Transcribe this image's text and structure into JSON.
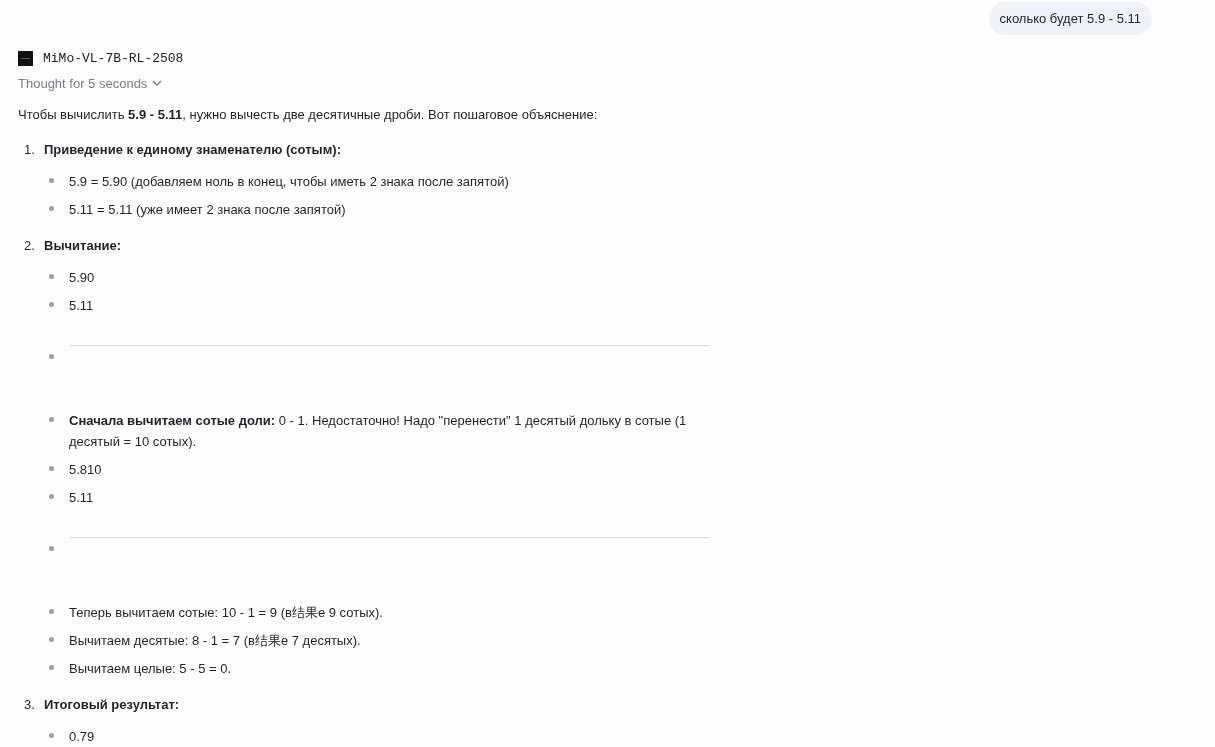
{
  "user_message": "сколько будет 5.9 - 5.11",
  "model": {
    "name": "MiMo-VL-7B-RL-2508"
  },
  "thought": {
    "label": "Thought for 5 seconds",
    "expanded": false
  },
  "intro": "Чтобы вычислить **5.9 - 5.11**, нужно вычесть две десятичные дроби. Вот пошаговое объяснение:",
  "steps": [
    {
      "number": "1.",
      "title": "Приведение к единому знаменателю (сотым):",
      "items": [
        {
          "kind": "text",
          "text": "5.9 = 5.90 (добавляем ноль в конец, чтобы иметь 2 знака после запятой)"
        },
        {
          "kind": "text",
          "text": "5.11 = 5.11 (уже имеет 2 знака после запятой)"
        }
      ]
    },
    {
      "number": "2.",
      "title": "Вычитание:",
      "items": [
        {
          "kind": "text",
          "text": "5.90"
        },
        {
          "kind": "text",
          "text": "5.11"
        },
        {
          "kind": "rule"
        },
        {
          "kind": "text",
          "text": "**Сначала вычитаем сотые доли:** 0 - 1. Недостаточно! Надо \"перенести\" 1 десятый дольку в сотые (1 десятый = 10 сотых)."
        },
        {
          "kind": "text",
          "text": "5.810"
        },
        {
          "kind": "text",
          "text": "5.11"
        },
        {
          "kind": "rule"
        },
        {
          "kind": "text",
          "text": "Теперь вычитаем сотые: 10 - 1 = 9 (в结果е 9 сотых)."
        },
        {
          "kind": "text",
          "text": "Вычитаем десятые: 8 - 1 = 7 (в结果е 7 десятых)."
        },
        {
          "kind": "text",
          "text": "Вычитаем целые: 5 - 5 = 0."
        }
      ]
    },
    {
      "number": "3.",
      "title": "Итоговый результат:",
      "items": [
        {
          "kind": "text",
          "text": "0.79"
        }
      ]
    }
  ]
}
